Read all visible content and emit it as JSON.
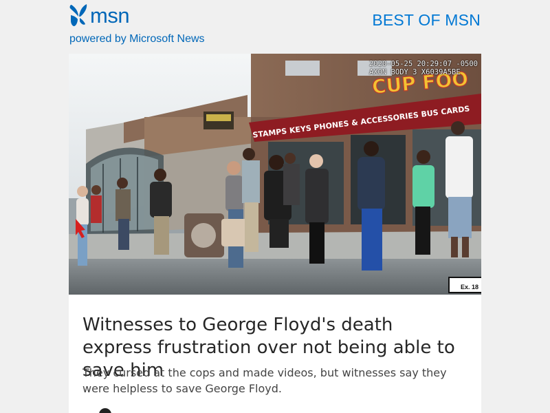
{
  "header": {
    "logo_text": "msn",
    "logo_icon": "msn-butterfly-icon",
    "tagline": "powered by Microsoft News",
    "best_of_link": "BEST OF MSN"
  },
  "article": {
    "image": {
      "timestamp_line1": "2020-05-25 20:29:07 -0500",
      "timestamp_line2": "AXON BODY 3 X6039A5BE",
      "store_sign": "CUP FOO",
      "awning_text": "STAMPS  KEYS  PHONES & ACCESSORIES  BUS CARDS",
      "exhibit_label": "Ex. 18"
    },
    "headline": "Witnesses to George Floyd's death express frustration over not being able to save him",
    "summary": "They cursed at the cops and made videos, but witnesses say they were helpless to save George Floyd.",
    "source_icon": "source-logo-icon"
  },
  "colors": {
    "brand_blue": "#0067b8",
    "link_blue": "#0078d4",
    "page_background": "#f0f0f0",
    "card_background": "#ffffff",
    "headline_text": "#262626",
    "awning_red": "#8e1c22",
    "sign_yellow": "#f2c233"
  }
}
